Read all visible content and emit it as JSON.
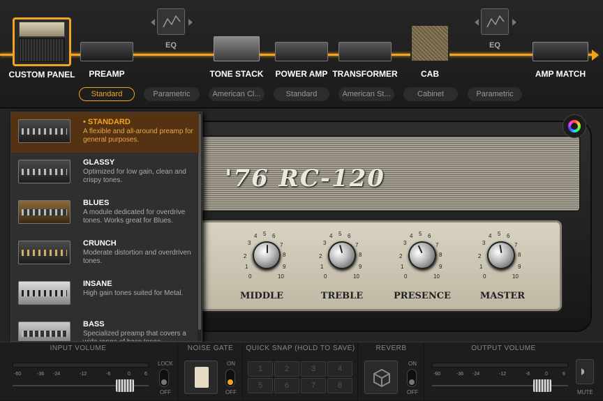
{
  "signal_chain": {
    "modules": [
      {
        "label": "CUSTOM PANEL",
        "selected": true
      },
      {
        "label": "PREAMP"
      },
      {
        "label": "TONE STACK"
      },
      {
        "label": "POWER AMP"
      },
      {
        "label": "TRANSFORMER"
      },
      {
        "label": "CAB"
      },
      {
        "label": "AMP MATCH"
      }
    ],
    "eq_labels": [
      "EQ",
      "EQ"
    ],
    "selectors": [
      "Standard",
      "Parametric",
      "American Cl...",
      "Standard",
      "American St...",
      "Cabinet",
      "Parametric"
    ],
    "active_color": "#f0a522"
  },
  "preamp_menu": {
    "items": [
      {
        "name": "• STANDARD",
        "desc": "A flexible and all-around preamp for general purposes.",
        "selected": true
      },
      {
        "name": "GLASSY",
        "desc": "Optimized for low gain, clean and crispy tones."
      },
      {
        "name": "BLUES",
        "desc": "A module dedicated for overdrive tones. Works great for Blues."
      },
      {
        "name": "CRUNCH",
        "desc": "Moderate distortion and overdriven tones."
      },
      {
        "name": "INSANE",
        "desc": "High gain tones suited for Metal."
      },
      {
        "name": "BASS",
        "desc": "Specialized preamp that covers a wide range of bass tones."
      }
    ]
  },
  "amp": {
    "brand": "'76 RC-120",
    "knobs": [
      {
        "label": "MIDDLE"
      },
      {
        "label": "TREBLE"
      },
      {
        "label": "PRESENCE"
      },
      {
        "label": "MASTER"
      }
    ],
    "scale_numbers": [
      "0",
      "1",
      "2",
      "3",
      "4",
      "5",
      "6",
      "7",
      "8",
      "9",
      "10"
    ]
  },
  "footer": {
    "input_volume": {
      "title": "INPUT VOLUME",
      "ticks": [
        "-60",
        "-36",
        "-24",
        "-12",
        "-6",
        "0",
        "6"
      ],
      "lock_label": "LOCK",
      "off_label": "OFF"
    },
    "noise_gate": {
      "title": "NOISE GATE",
      "on_label": "ON",
      "off_label": "OFF"
    },
    "quick_snap": {
      "title": "QUICK SNAP (HOLD TO SAVE)",
      "slots": [
        "1",
        "2",
        "3",
        "4",
        "5",
        "6",
        "7",
        "8"
      ]
    },
    "reverb": {
      "title": "REVERB",
      "on_label": "ON",
      "off_label": "OFF"
    },
    "output_volume": {
      "title": "OUTPUT VOLUME",
      "ticks": [
        "-60",
        "-36",
        "-24",
        "-12",
        "-6",
        "0",
        "6"
      ],
      "mute_label": "MUTE"
    }
  }
}
